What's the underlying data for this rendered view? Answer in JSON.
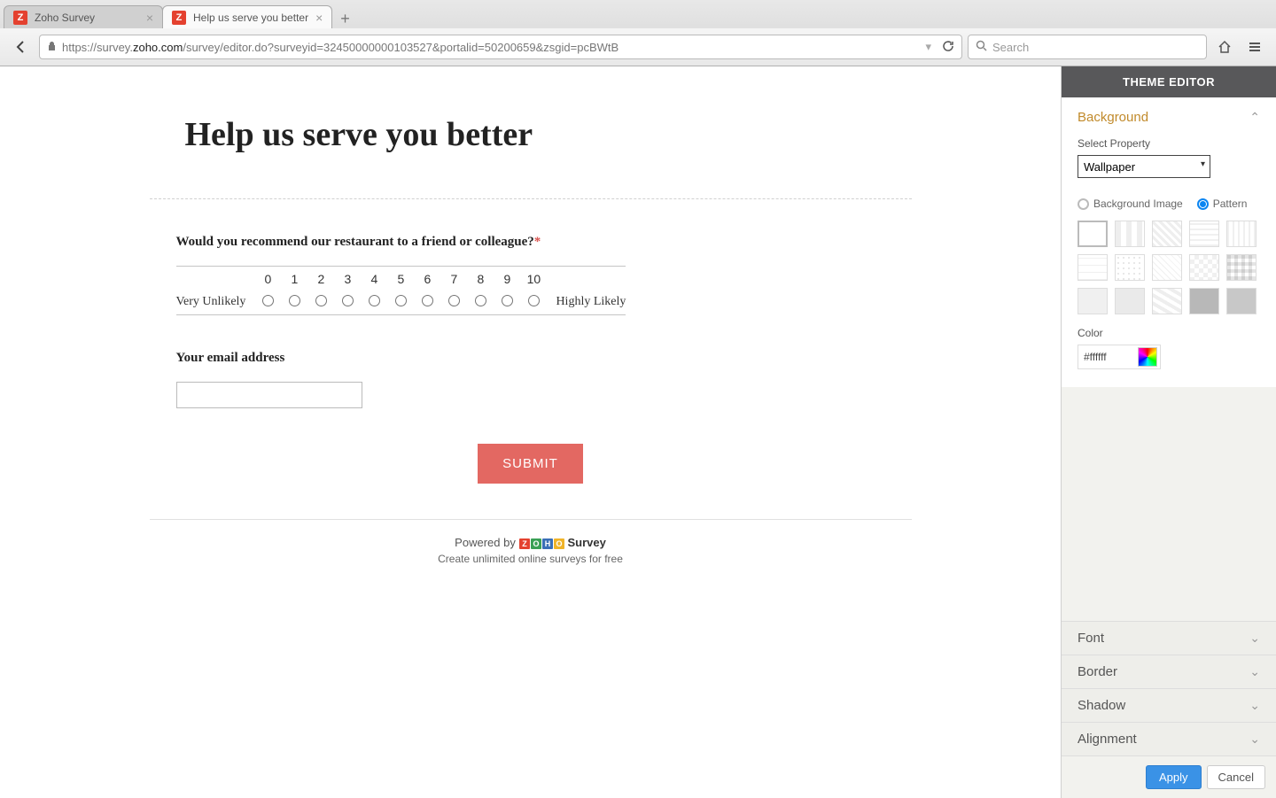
{
  "browser": {
    "tabs": [
      {
        "title": "Zoho Survey",
        "active": false
      },
      {
        "title": "Help us serve you better",
        "active": true
      }
    ],
    "url_prefix": "https://survey.",
    "url_domain": "zoho.com",
    "url_path": "/survey/editor.do?surveyid=32450000000103527&portalid=50200659&zsgid=pcBWtB",
    "search_placeholder": "Search"
  },
  "survey": {
    "title": "Help us serve you better",
    "q1": {
      "text": "Would you recommend our restaurant to a friend or colleague?",
      "required": "*",
      "scale": [
        "0",
        "1",
        "2",
        "3",
        "4",
        "5",
        "6",
        "7",
        "8",
        "9",
        "10"
      ],
      "left_label": "Very Unlikely",
      "right_label": "Highly Likely"
    },
    "q2": {
      "text": "Your email address",
      "value": ""
    },
    "submit_label": "SUBMIT",
    "footer": {
      "powered_by": "Powered by",
      "brand": "Survey",
      "tagline": "Create unlimited online surveys for free"
    }
  },
  "theme_editor": {
    "header": "THEME EDITOR",
    "sections": {
      "background": {
        "title": "Background",
        "select_property_label": "Select Property",
        "select_property_value": "Wallpaper",
        "radio_image": "Background Image",
        "radio_pattern": "Pattern",
        "radio_selected": "pattern",
        "color_label": "Color",
        "color_value": "#ffffff"
      },
      "font": "Font",
      "border": "Border",
      "shadow": "Shadow",
      "alignment": "Alignment"
    },
    "apply_label": "Apply",
    "cancel_label": "Cancel"
  }
}
